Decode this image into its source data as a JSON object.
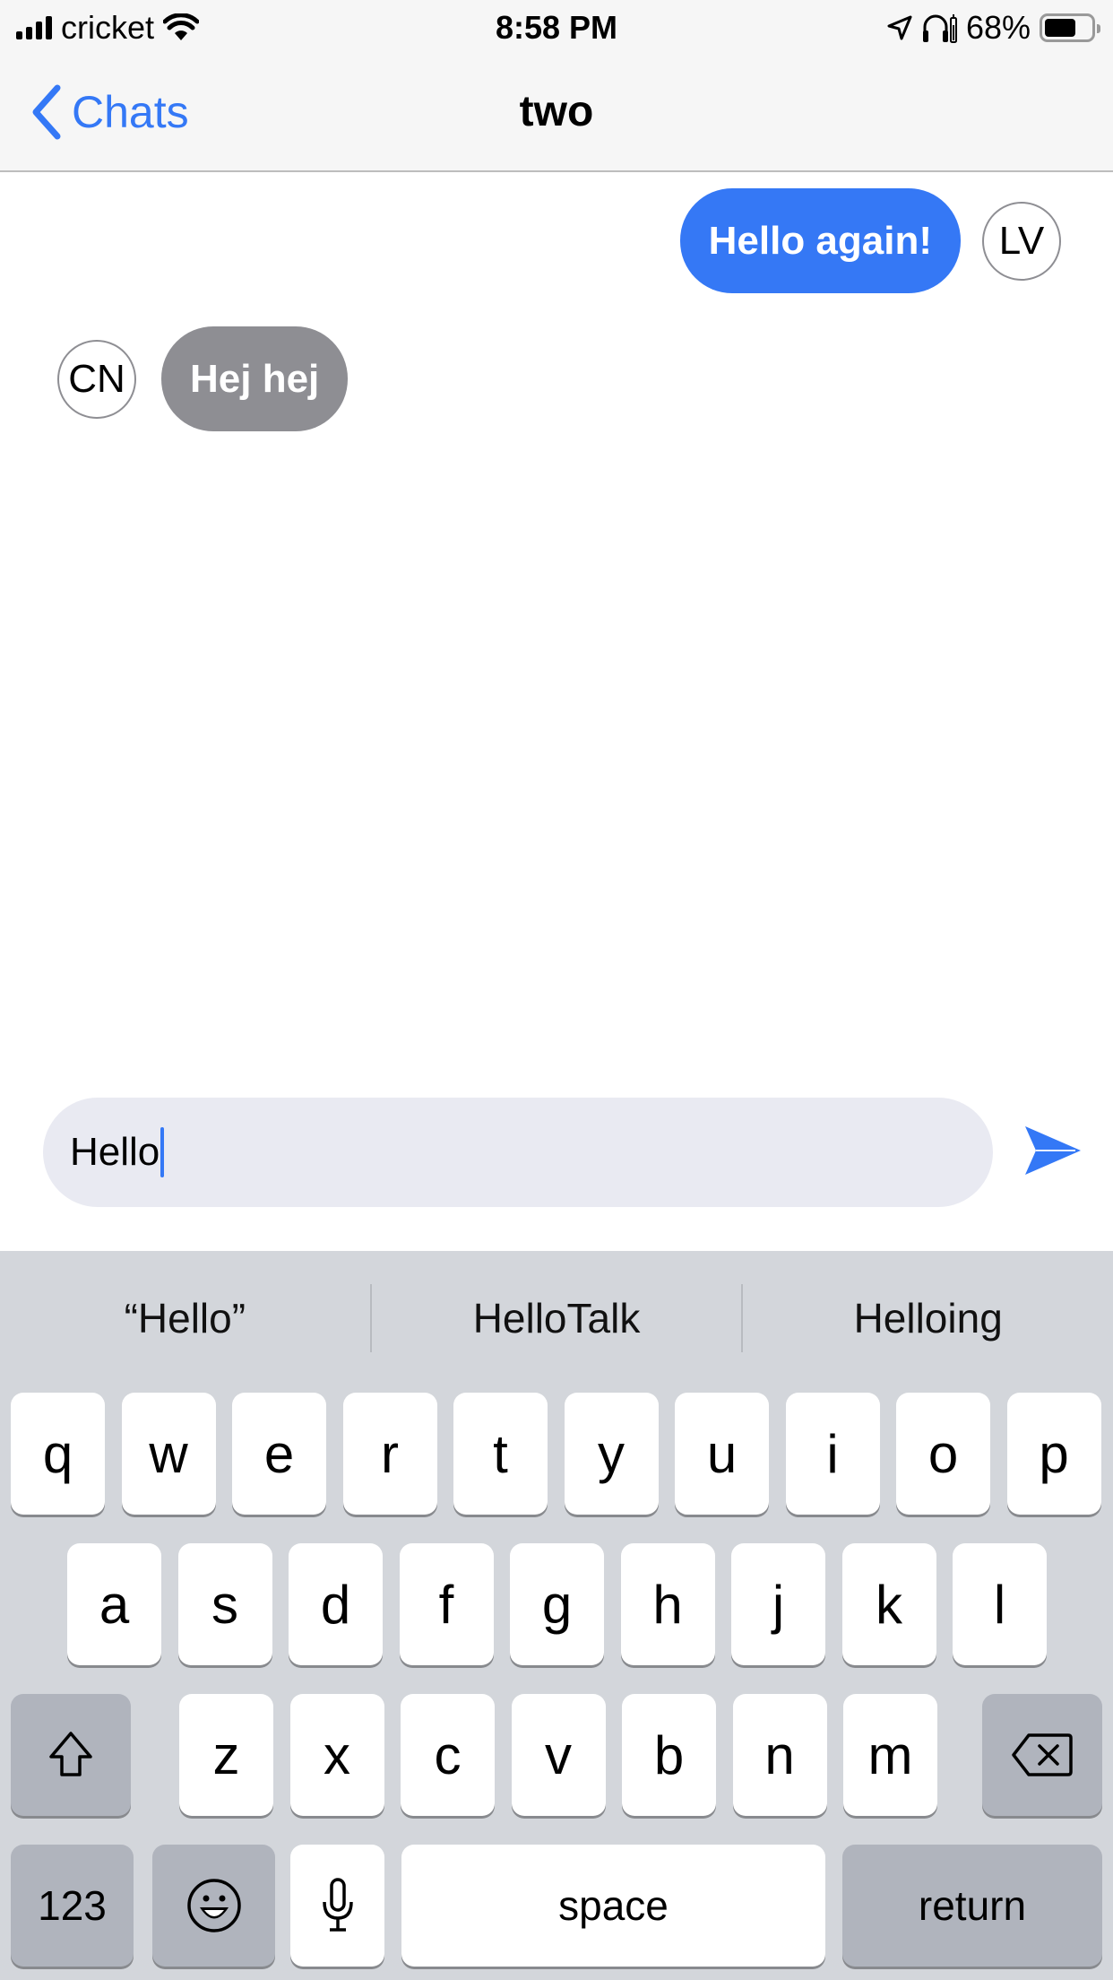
{
  "status_bar": {
    "carrier": "cricket",
    "time": "8:58 PM",
    "battery_percent": "68%",
    "battery_level": 0.68,
    "icons": [
      "signal-icon",
      "wifi-icon",
      "location-arrow-icon",
      "headphones-icon",
      "battery-icon"
    ]
  },
  "nav": {
    "back_label": "Chats",
    "title": "two"
  },
  "messages": [
    {
      "direction": "outgoing",
      "text": "Hello again!",
      "avatar_initials": "LV"
    },
    {
      "direction": "incoming",
      "text": "Hej hej",
      "avatar_initials": "CN"
    }
  ],
  "composer": {
    "value": "Hello",
    "send_icon": "send-icon"
  },
  "keyboard": {
    "suggestions": [
      "“Hello”",
      "HelloTalk",
      "Helloing"
    ],
    "row1": [
      "q",
      "w",
      "e",
      "r",
      "t",
      "y",
      "u",
      "i",
      "o",
      "p"
    ],
    "row2": [
      "a",
      "s",
      "d",
      "f",
      "g",
      "h",
      "j",
      "k",
      "l"
    ],
    "row3": [
      "z",
      "x",
      "c",
      "v",
      "b",
      "n",
      "m"
    ],
    "numbers_label": "123",
    "space_label": "space",
    "return_label": "return",
    "shift_icon": "shift-icon",
    "delete_icon": "delete-icon",
    "emoji_icon": "emoji-icon",
    "mic_icon": "microphone-icon"
  },
  "colors": {
    "accent": "#3478f6",
    "outgoing_bubble": "#3578f5",
    "incoming_bubble": "#8e8e93",
    "composer_bg": "#e9eaf2",
    "keyboard_bg": "#d3d6db"
  }
}
